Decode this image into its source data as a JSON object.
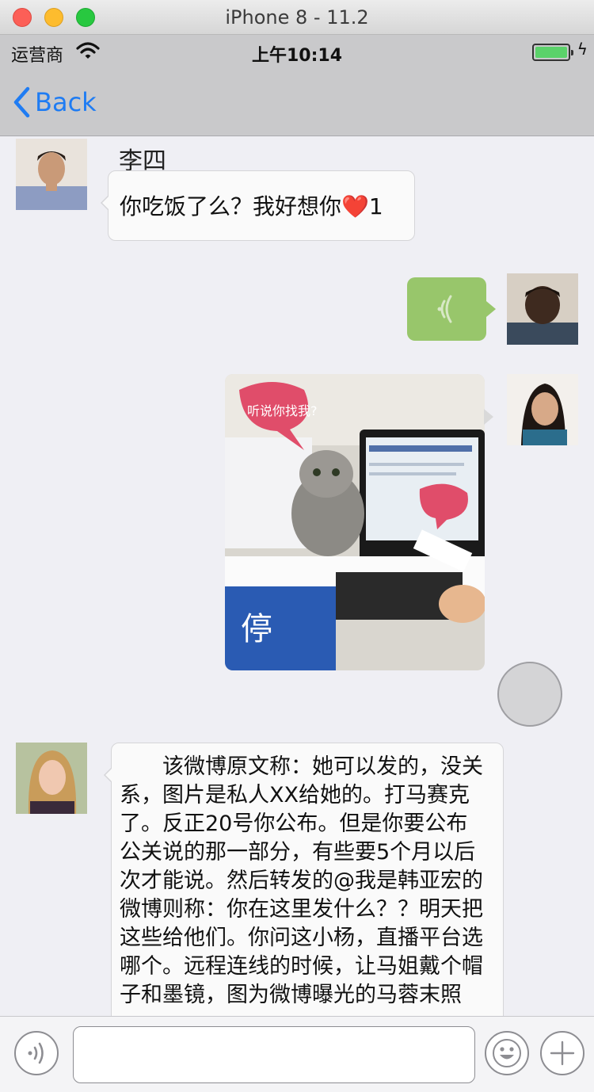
{
  "window": {
    "title": "iPhone 8 - 11.2"
  },
  "status_bar": {
    "carrier": "运营商",
    "time": "上午10:14"
  },
  "nav": {
    "back_label": "Back"
  },
  "messages": [
    {
      "sender": "李四",
      "side": "left",
      "type": "text",
      "text": "你吃饭了么？我好想你❤️1"
    },
    {
      "side": "right",
      "type": "voice"
    },
    {
      "side": "right",
      "type": "image",
      "image_text": "听说你找我?"
    },
    {
      "side": "left",
      "type": "text",
      "text": "该微博原文称：她可以发的，没关系，图片是私人XX给她的。打马赛克了。反正20号你公布。但是你要公布公关说的那一部分，有些要5个月以后次才能说。然后转发的@我是韩亚宏的微博则称：你在这里发什么？？明天把这些给他们。你问这小杨，直播平台选哪个。远程连线的时候，让马姐戴个帽子和墨镜，图为微博曝光的马蓉末照"
    }
  ],
  "input": {
    "placeholder": ""
  },
  "colors": {
    "accent": "#1f7cf3",
    "voice_bubble": "#98c66b",
    "background": "#efeff4"
  }
}
